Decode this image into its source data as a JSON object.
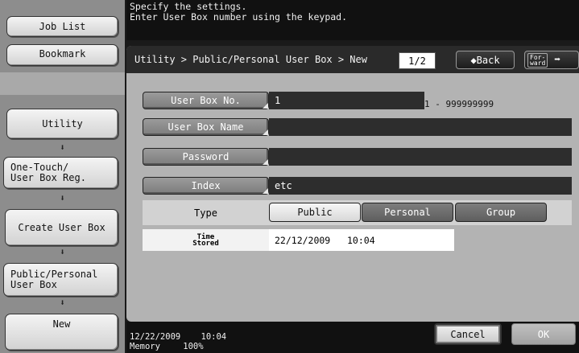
{
  "left_nav": {
    "job_list_label": "Job List",
    "bookmark_label": "Bookmark",
    "crumbs": [
      {
        "label": "Utility"
      },
      {
        "label": "One-Touch/\nUser Box Reg."
      },
      {
        "label": "Create User Box"
      },
      {
        "label": "Public/Personal\nUser Box"
      },
      {
        "label": "New"
      }
    ],
    "arrow_glyph": "⬇"
  },
  "message": {
    "line1": "Specify the settings.",
    "line2": "Enter User Box number using the keypad."
  },
  "header": {
    "path": "Utility > Public/Personal User Box > New",
    "page_indicator": "1/2",
    "back_label": "◆Back",
    "forward_label": "For-\nward",
    "forward_arrow": "➡"
  },
  "form": {
    "user_box_no": {
      "label": "User Box No.",
      "value": "1",
      "range": "1 - 999999999"
    },
    "user_box_name": {
      "label": "User Box Name",
      "value": ""
    },
    "password": {
      "label": "Password",
      "value": ""
    },
    "index": {
      "label": "Index",
      "value": "etc"
    },
    "type": {
      "label": "Type",
      "options": [
        "Public",
        "Personal",
        "Group"
      ],
      "selected": "Public"
    },
    "time_stored": {
      "label_line1": "Time",
      "label_line2": "Stored",
      "value": "22/12/2009   10:04"
    }
  },
  "footer": {
    "datetime": "12/22/2009    10:04",
    "memory_label": "Memory",
    "memory_value": "100%",
    "cancel_label": "Cancel",
    "ok_label": "OK"
  }
}
